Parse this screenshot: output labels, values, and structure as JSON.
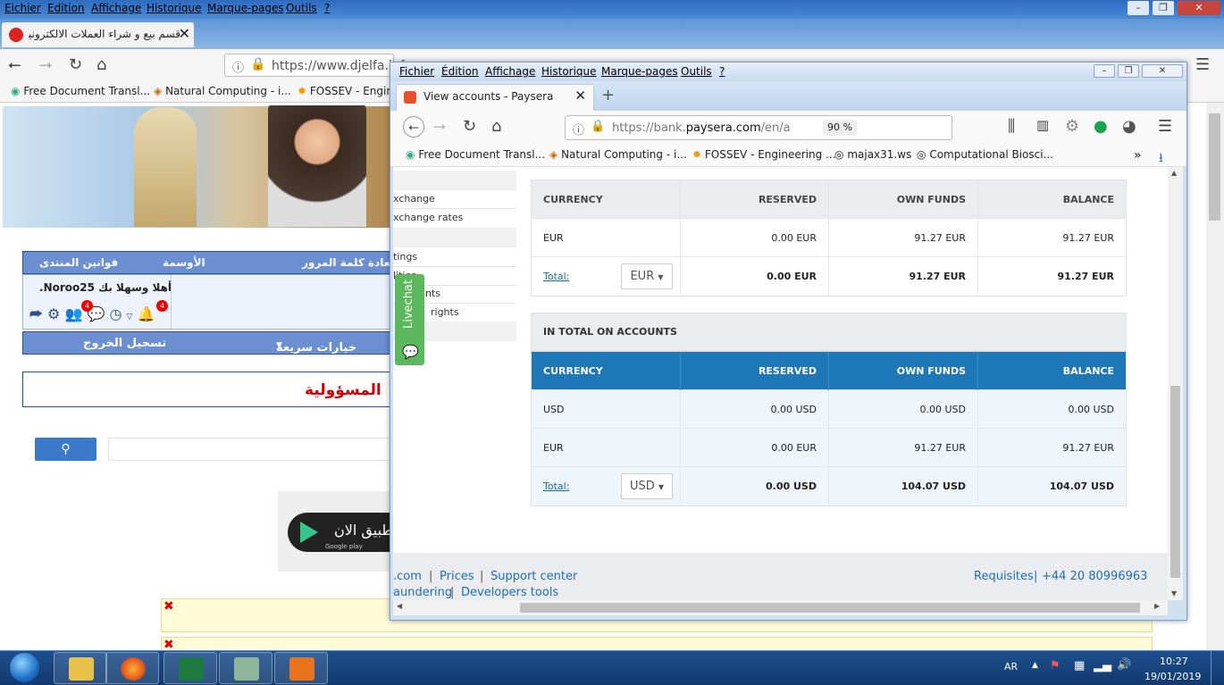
{
  "bg": {
    "menu": [
      "Eichier",
      "Edition",
      "Affichage",
      "Historique",
      "Marque-pages",
      "Outils",
      "?"
    ],
    "tab_title": "قسم بيع و شراء العملات الالكترونية",
    "url": "https://www.djelfa.info",
    "bookmarks": [
      "Free Document Transl...",
      "Natural Computing - i...",
      "FOSSEV - Engin"
    ],
    "forum_nav": [
      "قوانين المنتدى",
      "الأوسمة",
      "استعادة كلمة المرور"
    ],
    "welcome": "أهلا وسهلا بك Noroo25.",
    "badges": [
      "4",
      "4"
    ],
    "quick_options": "خيارات سريعة",
    "logout": "تسجيل الخروج",
    "responsibility": "المسؤولية",
    "app_text": "طبيق الان",
    "google_play": "Google play"
  },
  "win": {
    "menu": [
      "Fichier",
      "Édition",
      "Affichage",
      "Historique",
      "Marque-pages",
      "Outils",
      "?"
    ],
    "tab_title": "View accounts - Paysera",
    "url_prefix": "https://bank.",
    "url_domain": "paysera.com",
    "url_suffix": "/en/acc",
    "zoom": "90 %",
    "bookmarks": [
      "Free Document Transl...",
      "Natural Computing - i...",
      "FOSSEV - Engineering ...",
      "majax31.ws",
      "Computational Biosci..."
    ]
  },
  "sidebar": {
    "items": [
      "xchange",
      "xchange rates",
      "tings",
      "lities",
      "nts",
      "rights"
    ],
    "livechat": "Livechat"
  },
  "table1": {
    "headers": [
      "CURRENCY",
      "RESERVED",
      "OWN FUNDS",
      "BALANCE"
    ],
    "rows": [
      [
        "EUR",
        "0.00 EUR",
        "91.27 EUR",
        "91.27 EUR"
      ]
    ],
    "total_label": "Total:",
    "total_currency": "EUR",
    "total": [
      "0.00 EUR",
      "91.27 EUR",
      "91.27 EUR"
    ]
  },
  "table2": {
    "title": "IN TOTAL ON ACCOUNTS",
    "headers": [
      "CURRENCY",
      "RESERVED",
      "OWN FUNDS",
      "BALANCE"
    ],
    "rows": [
      [
        "USD",
        "0.00 USD",
        "0.00 USD",
        "0.00 USD"
      ],
      [
        "EUR",
        "0.00 EUR",
        "91.27 EUR",
        "91.27 EUR"
      ]
    ],
    "total_label": "Total:",
    "total_currency": "USD",
    "total": [
      "0.00 USD",
      "104.07 USD",
      "104.07 USD"
    ]
  },
  "footer": {
    "links1": [
      ".com",
      "Prices",
      "Support center"
    ],
    "links2": [
      "aundering",
      "Developers tools"
    ],
    "requisites": "Requisites",
    "phone": "+44 20 80996963"
  },
  "tray": {
    "lang": "AR",
    "time": "10:27",
    "date": "19/01/2019"
  },
  "colors": {
    "header_blue": "#1e78b8",
    "livechat_green": "#5cb85c",
    "link_blue": "#1e6fb0"
  }
}
